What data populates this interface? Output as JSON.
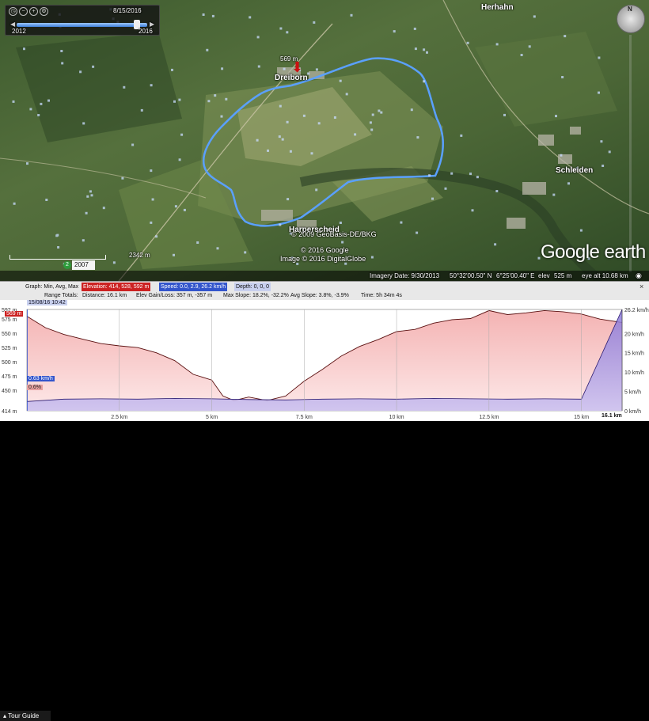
{
  "time_slider": {
    "current_date": "8/15/2016",
    "start_year": "2012",
    "end_year": "2016"
  },
  "map": {
    "places": {
      "herhahn": "Herhahn",
      "dreiborn": "Dreiborn",
      "schleiden": "Schleiden",
      "harperscheid": "Harperscheid"
    },
    "elevation_marker": "569 m",
    "elevation_marker2": "2342 m",
    "year_badge": "2007",
    "copyright": [
      "© 2009 GeoBasis-DE/BKG",
      "© 2016 Google",
      "Image © 2016 DigitalGlobe"
    ],
    "logo": "Google earth",
    "colors": {
      "track": "#5aa0ff",
      "marker": "#cc1111"
    }
  },
  "status_bar": {
    "imagery_date": "Imagery Date: 9/30/2013",
    "lat": "50°32'00.50\" N",
    "lon": "6°25'00.40\" E",
    "elev_label": "elev",
    "elev": "525 m",
    "eye_alt": "eye alt  10.68 km"
  },
  "info_bar": {
    "graph_label": "Graph: Min, Avg, Max",
    "elevation": "Elevation: 414, 528, 592 m",
    "speed": "Speed: 0.0, 2.9, 26.2 km/h",
    "depth": "Depth: 0, 0, 0",
    "range_label": "Range Totals:",
    "distance": "Distance: 16.1 km",
    "gain_loss": "Elev Gain/Loss: 357 m, -357 m",
    "max_slope": "Max Slope: 18.2%, -32.2%",
    "avg_slope": "Avg Slope: 3.8%, -3.9%",
    "time": "Time: 5h 34m 4s",
    "close": "×"
  },
  "profile": {
    "timestamp": "15/08/16 10:42",
    "current_elev": "569 m",
    "current_speed": "0.63 km/h",
    "current_slope": "0.6%",
    "end_label": "16.1 km",
    "tour_guide": "Tour Guide",
    "y_left": [
      "592 m",
      "575 m",
      "550 m",
      "525 m",
      "500 m",
      "475 m",
      "450 m",
      "414 m"
    ],
    "y_right": [
      "26.2 km/h",
      "20 km/h",
      "15 km/h",
      "10 km/h",
      "5 km/h",
      "0 km/h"
    ],
    "x_labels": [
      "2.5 km",
      "5 km",
      "7.5 km",
      "10 km",
      "12.5 km",
      "15 km"
    ]
  },
  "chart_data": {
    "type": "area",
    "title": "",
    "xlabel": "",
    "ylabel": "",
    "ylim": [
      414,
      592
    ],
    "y2lim": [
      0,
      26.2
    ],
    "xlim": [
      0,
      16.1
    ],
    "series": [
      {
        "name": "Elevation",
        "x": [
          0,
          0.5,
          1,
          1.5,
          2,
          2.5,
          3,
          3.5,
          4,
          4.5,
          5,
          5.3,
          5.6,
          6,
          6.5,
          7,
          7.5,
          8,
          8.5,
          9,
          9.5,
          10,
          10.5,
          11,
          11.5,
          12,
          12.5,
          13,
          13.5,
          14,
          14.5,
          15,
          15.5,
          16.1
        ],
        "values": [
          580,
          560,
          548,
          540,
          532,
          528,
          525,
          516,
          502,
          478,
          468,
          440,
          432,
          438,
          432,
          440,
          466,
          487,
          510,
          527,
          539,
          553,
          557,
          568,
          574,
          576,
          590,
          583,
          586,
          590,
          588,
          584,
          575,
          569
        ]
      },
      {
        "name": "Speed",
        "x": [
          0,
          1,
          2,
          3,
          4,
          5,
          6,
          7,
          8,
          9,
          10,
          11,
          12,
          13,
          14,
          15,
          16.1
        ],
        "values": [
          2.4,
          3.0,
          3.1,
          3.0,
          3.2,
          3.1,
          2.9,
          2.8,
          3.0,
          3.1,
          3.0,
          3.2,
          3.1,
          3.0,
          3.1,
          3.0,
          26.2
        ]
      }
    ]
  }
}
